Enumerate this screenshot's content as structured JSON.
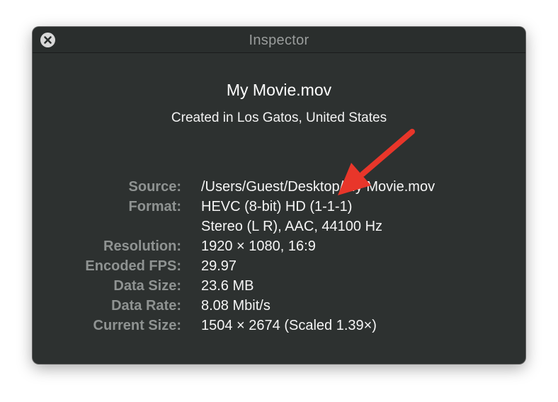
{
  "window": {
    "title": "Inspector"
  },
  "header": {
    "file_name": "My Movie.mov",
    "location": "Created in Los Gatos, United States"
  },
  "info": {
    "rows": [
      {
        "label": "Source:",
        "value": "/Users/Guest/Desktop/My Movie.mov"
      },
      {
        "label": "Format:",
        "value": "HEVC (8-bit) HD (1-1-1)"
      },
      {
        "label": "",
        "value": "Stereo (L R), AAC, 44100 Hz"
      },
      {
        "label": "Resolution:",
        "value": "1920 × 1080, 16:9"
      },
      {
        "label": "Encoded FPS:",
        "value": "29.97"
      },
      {
        "label": "Data Size:",
        "value": "23.6 MB"
      },
      {
        "label": "Data Rate:",
        "value": "8.08 Mbit/s"
      },
      {
        "label": "Current Size:",
        "value": "1504 × 2674 (Scaled 1.39×)"
      }
    ]
  },
  "annotation": {
    "arrow_color": "#e8362a"
  }
}
